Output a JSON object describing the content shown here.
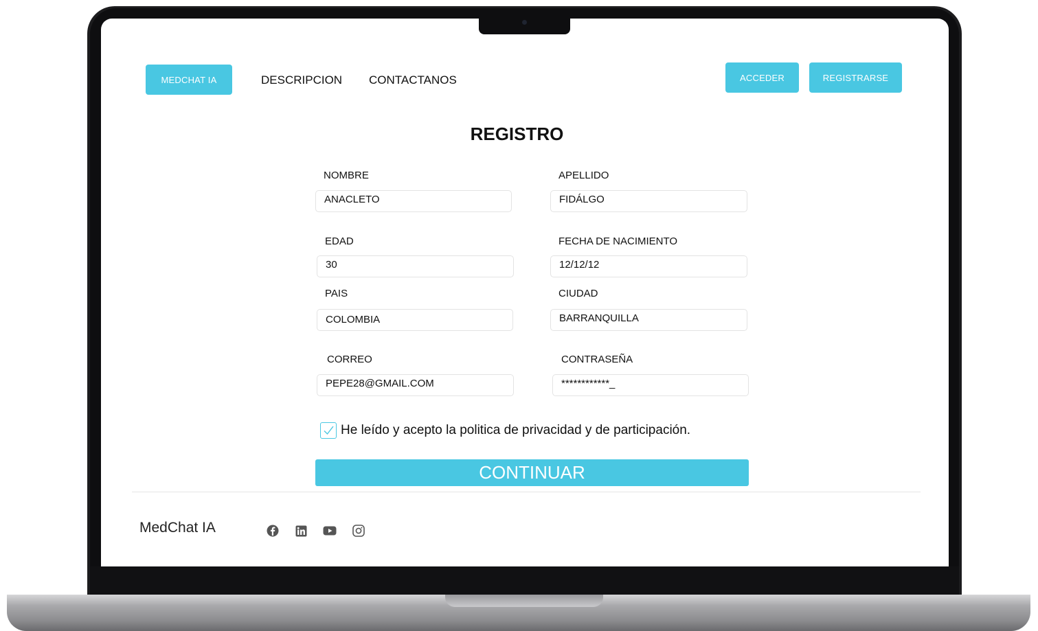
{
  "nav": {
    "brand": "MEDCHAT IA",
    "links": [
      "DESCRIPCION",
      "CONTACTANOS"
    ],
    "login": "ACCEDER",
    "register": "REGISTRARSE"
  },
  "form": {
    "title": "REGISTRO",
    "fields": [
      {
        "label": "NOMBRE",
        "value": "ANACLETO"
      },
      {
        "label": "APELLIDO",
        "value": "FIDÁLGO"
      },
      {
        "label": "EDAD",
        "value": "30"
      },
      {
        "label": "FECHA DE NACIMIENTO",
        "value": "12/12/12"
      },
      {
        "label": "PAIS",
        "value": "COLOMBIA"
      },
      {
        "label": "CIUDAD",
        "value": "BARRANQUILLA"
      },
      {
        "label": "CORREO",
        "value": "PEPE28@GMAIL.COM"
      },
      {
        "label": "CONTRASEÑA",
        "value": "************_"
      }
    ],
    "consent": "He leído y acepto la politica de privacidad y de participación.",
    "consent_checked": true,
    "continue": "CONTINUAR"
  },
  "footer": {
    "brand": "MedChat IA",
    "social_icons": [
      "facebook-icon",
      "linkedin-icon",
      "youtube-icon",
      "instagram-icon"
    ]
  },
  "colors": {
    "accent": "#49c7e2"
  }
}
